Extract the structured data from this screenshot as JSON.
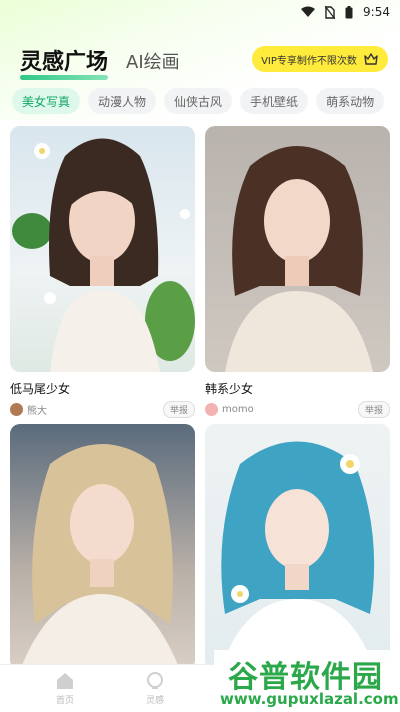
{
  "status_bar": {
    "time": "9:54"
  },
  "header": {
    "active_tab": "灵感广场",
    "inactive_tab": "AI绘画"
  },
  "vip_banner": {
    "label": "VIP专享制作不限次数"
  },
  "categories": [
    "美女写真",
    "动漫人物",
    "仙侠古风",
    "手机壁纸",
    "萌系动物"
  ],
  "cards": [
    {
      "title": "低马尾少女",
      "author": "熊大",
      "report": "举报"
    },
    {
      "title": "韩系少女",
      "author": "momo",
      "report": "举报"
    },
    {
      "title": "",
      "author": "",
      "report": ""
    },
    {
      "title": "",
      "author": "",
      "report": ""
    }
  ],
  "bottom_nav": [
    {
      "label": "首页",
      "icon": "home-icon"
    },
    {
      "label": "灵感",
      "icon": "inspiration-icon"
    }
  ],
  "watermark": {
    "name": "谷普软件园",
    "url": "www.gupuxlazal.com"
  },
  "colors": {
    "accent": "#12a866",
    "vip_bg": "#ffeb3b",
    "chip_active_bg": "#dff8ec"
  }
}
